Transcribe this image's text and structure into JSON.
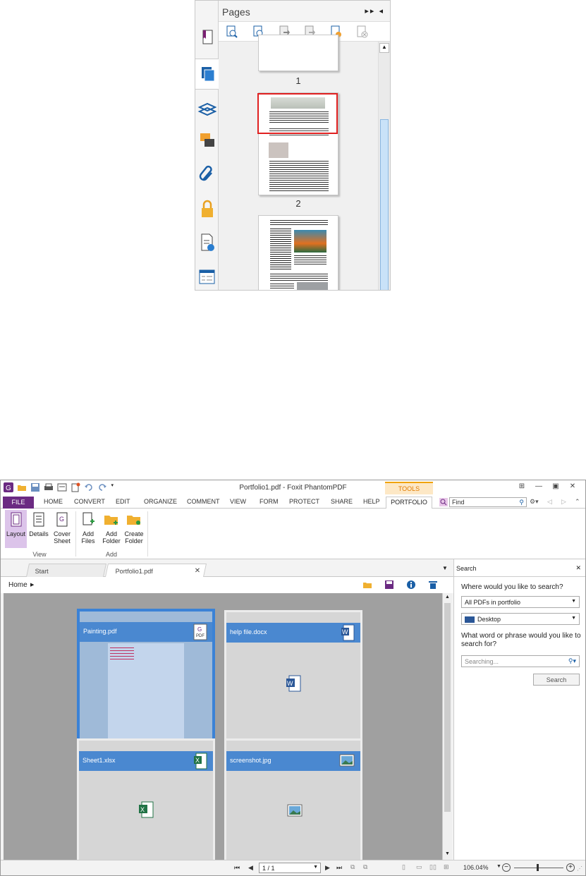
{
  "pages_panel": {
    "title": "Pages",
    "controls": "▸▸ ◂",
    "thumbnails": [
      {
        "label": "1"
      },
      {
        "label": "2"
      },
      {
        "label": ""
      }
    ],
    "side_icons": [
      "bookmark-icon",
      "pages-icon",
      "layers-icon",
      "comments-icon",
      "attachments-icon",
      "security-icon",
      "signature-icon",
      "content-icon"
    ],
    "tool_icons": [
      "zoom-in-page-icon",
      "zoom-out-page-icon",
      "insert-page-icon",
      "extract-page-icon",
      "add-page-icon",
      "delete-page-icon"
    ]
  },
  "window": {
    "title": "Portfolio1.pdf - Foxit PhantomPDF",
    "context_tab": "TOOLS",
    "ribbon_tabs": [
      "FILE",
      "HOME",
      "CONVERT",
      "EDIT",
      "ORGANIZE",
      "COMMENT",
      "VIEW",
      "FORM",
      "PROTECT",
      "SHARE",
      "HELP",
      "PORTFOLIO"
    ],
    "find_placeholder": "Find",
    "ribbon": {
      "layout": "Layout",
      "details": "Details",
      "cover_sheet": "Cover Sheet",
      "add_files": "Add Files",
      "add_folder": "Add Folder",
      "create_folder": "Create Folder",
      "group_view": "View",
      "group_add": "Add"
    },
    "doc_tabs": {
      "start": "Start",
      "portfolio": "Portfolio1.pdf"
    },
    "breadcrumb": "Home",
    "files": [
      {
        "name": "Painting.pdf",
        "type": "pdf"
      },
      {
        "name": "help file.docx",
        "type": "docx"
      },
      {
        "name": "Sheet1.xlsx",
        "type": "xlsx"
      },
      {
        "name": "screenshot.jpg",
        "type": "jpg"
      }
    ],
    "search": {
      "title": "Search",
      "q1": "Where would you like to search?",
      "scope": "All PDFs in portfolio",
      "location": "Desktop",
      "q2": "What word or phrase would you like to search for?",
      "placeholder": "Searching...",
      "button": "Search"
    },
    "status": {
      "page": "1 / 1",
      "zoom": "106.04%"
    },
    "colors": {
      "accent": "#4a88d0",
      "file_tab": "#6b2a82"
    }
  }
}
